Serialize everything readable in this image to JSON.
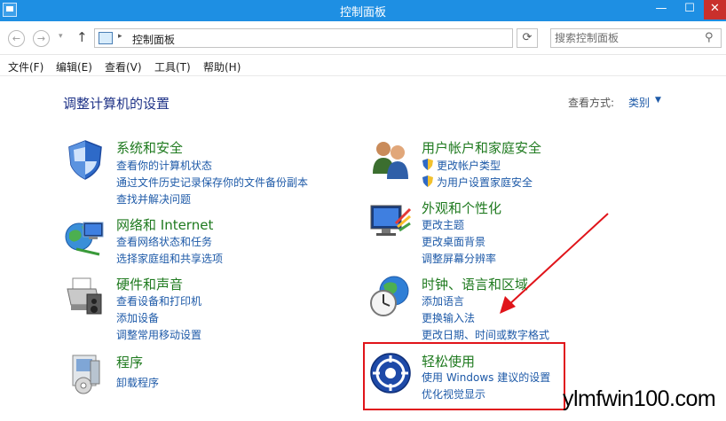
{
  "window": {
    "title": "控制面板",
    "minimize": "—",
    "maximize": "☐",
    "close": "✕"
  },
  "address": {
    "back": "←",
    "forward": "→",
    "recent": "▾",
    "up": "↑",
    "separator": "▸",
    "path": "控制面板",
    "dropdown": "▾",
    "refresh": "⟳",
    "search_placeholder": "搜索控制面板",
    "search_icon": "⚲"
  },
  "menu": {
    "items": [
      "文件(F)",
      "编辑(E)",
      "查看(V)",
      "工具(T)",
      "帮助(H)"
    ]
  },
  "page": {
    "title": "调整计算机的设置",
    "view_by_label": "查看方式:",
    "view_by_value": "类别",
    "view_by_caret": "▼"
  },
  "categories": {
    "system": {
      "icon": "shield-icon",
      "title": "系统和安全",
      "links": [
        "查看你的计算机状态",
        "通过文件历史记录保存你的文件备份副本",
        "查找并解决问题"
      ]
    },
    "network": {
      "icon": "network-globe-icon",
      "title": "网络和 Internet",
      "links": [
        "查看网络状态和任务",
        "选择家庭组和共享选项"
      ]
    },
    "hardware": {
      "icon": "printer-icon",
      "title": "硬件和声音",
      "links": [
        "查看设备和打印机",
        "添加设备",
        "调整常用移动设置"
      ]
    },
    "programs": {
      "icon": "programs-icon",
      "title": "程序",
      "links": [
        "卸载程序"
      ]
    },
    "users": {
      "icon": "users-icon",
      "title": "用户帐户和家庭安全",
      "links": [
        "更改帐户类型",
        "为用户设置家庭安全"
      ]
    },
    "appearance": {
      "icon": "monitor-palette-icon",
      "title": "外观和个性化",
      "links": [
        "更改主题",
        "更改桌面背景",
        "调整屏幕分辨率"
      ]
    },
    "clock": {
      "icon": "clock-globe-icon",
      "title": "时钟、语言和区域",
      "links": [
        "添加语言",
        "更换输入法",
        "更改日期、时间或数字格式"
      ]
    },
    "ease": {
      "icon": "ease-of-access-icon",
      "title": "轻松使用",
      "links": [
        "使用 Windows 建议的设置",
        "优化视觉显示"
      ]
    }
  },
  "annotation": {
    "highlight_color": "#e0141a",
    "arrow_color": "#e0141a"
  },
  "watermark": "ylmfwin100.com",
  "colors": {
    "titlebar": "#1e8fe3",
    "category_title": "#1f7a1f",
    "link": "#1e5aa8",
    "page_title": "#1e3287"
  }
}
